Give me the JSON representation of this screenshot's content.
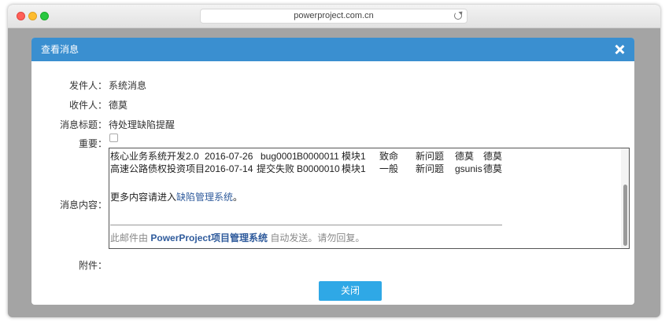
{
  "browser": {
    "url": "powerproject.com.cn"
  },
  "dialog": {
    "title": "查看消息",
    "close_button_label": "关闭"
  },
  "message": {
    "sender_label": "发件人：",
    "sender": "系统消息",
    "recipient_label": "收件人：",
    "recipient": "德莫",
    "subject_label": "消息标题：",
    "subject": "待处理缺陷提醒",
    "important_label": "重要：",
    "important": false,
    "content_label": "消息内容：",
    "attachment_label": "附件："
  },
  "content": {
    "rows": [
      {
        "project": "核心业务系统开发2.0",
        "date": "2016-07-26",
        "title": "bug0001",
        "id": "B0000011",
        "module": "模块1",
        "severity": "致命",
        "status": "新问题",
        "assignee": "德莫",
        "reporter": "德莫"
      },
      {
        "project": "高速公路债权投资项目",
        "date": "2016-07-14",
        "title": "提交失败",
        "id": "B0000010",
        "module": "模块1",
        "severity": "一般",
        "status": "新问题",
        "assignee": "gsunis",
        "reporter": "德莫"
      }
    ],
    "more_text": "更多内容请进入",
    "more_link": "缺陷管理系统",
    "more_suffix": "。",
    "footer_prefix": "此邮件由",
    "footer_system": "PowerProject项目管理系统",
    "footer_suffix": "自动发送。请勿回复。"
  },
  "colors": {
    "header": "#3a8fd0",
    "button": "#2fa8e6",
    "link": "#2f5b9c"
  },
  "icons": {
    "reload": "reload-icon",
    "close": "close-icon"
  }
}
